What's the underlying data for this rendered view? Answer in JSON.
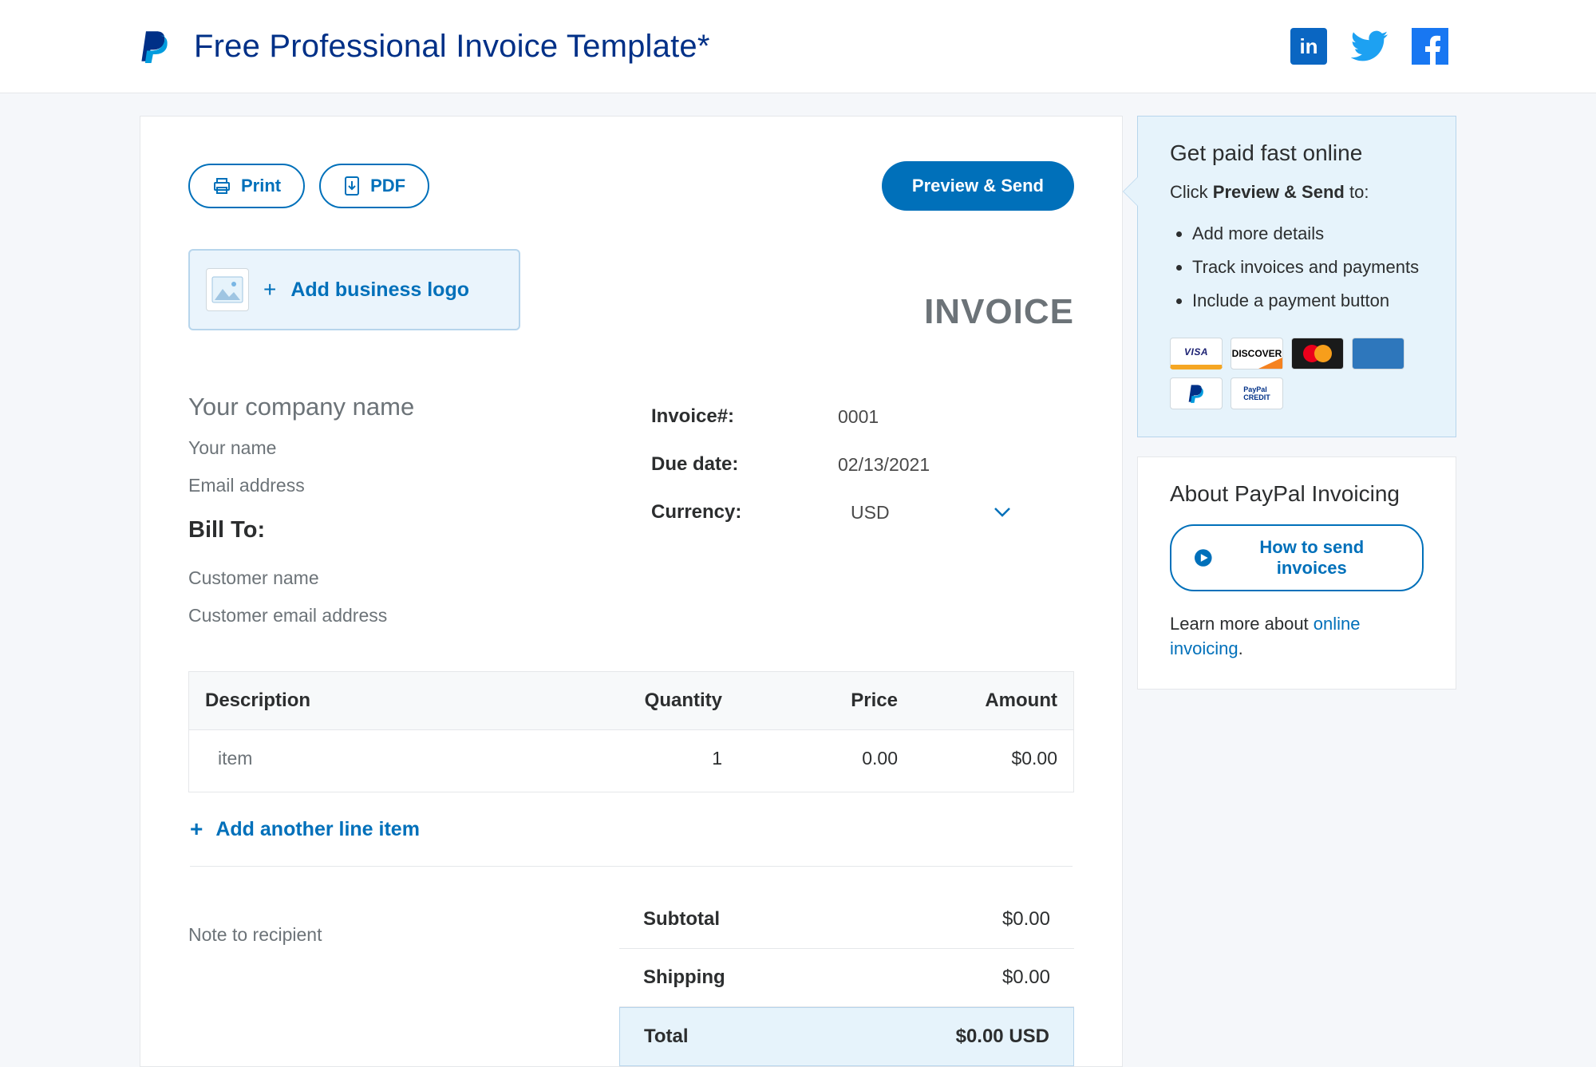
{
  "header": {
    "title": "Free Professional Invoice Template*"
  },
  "toolbar": {
    "print": "Print",
    "pdf": "PDF",
    "preview_send": "Preview & Send"
  },
  "upload": {
    "label": "Add business logo"
  },
  "invoice": {
    "title": "INVOICE",
    "company_placeholder": "Your company name",
    "yourname_placeholder": "Your name",
    "email_placeholder": "Email address",
    "labels": {
      "number": "Invoice#:",
      "due": "Due date:",
      "currency": "Currency:"
    },
    "number": "0001",
    "due": "02/13/2021",
    "currency": "USD"
  },
  "billto": {
    "heading": "Bill To:",
    "name_placeholder": "Customer name",
    "email_placeholder": "Customer email address"
  },
  "items": {
    "headers": {
      "desc": "Description",
      "qty": "Quantity",
      "price": "Price",
      "amount": "Amount"
    },
    "rows": [
      {
        "desc": "item",
        "qty": "1",
        "price": "0.00",
        "amount": "$0.00"
      }
    ],
    "add_line": "Add another line item"
  },
  "note": {
    "placeholder": "Note to recipient"
  },
  "totals": {
    "subtotal": {
      "label": "Subtotal",
      "value": "$0.00"
    },
    "shipping": {
      "label": "Shipping",
      "value": "$0.00"
    },
    "total": {
      "label": "Total",
      "value": "$0.00 USD"
    }
  },
  "side": {
    "getpaid": {
      "heading": "Get paid fast online",
      "sub_pre": "Click ",
      "sub_bold": "Preview & Send",
      "sub_post": " to:",
      "bullets": [
        "Add more details",
        "Track invoices and payments",
        "Include a payment button"
      ]
    },
    "about": {
      "heading": "About PayPal Invoicing",
      "how_btn": "How to send invoices",
      "learn_pre": "Learn more about ",
      "learn_link": "online invoicing",
      "learn_post": "."
    }
  }
}
